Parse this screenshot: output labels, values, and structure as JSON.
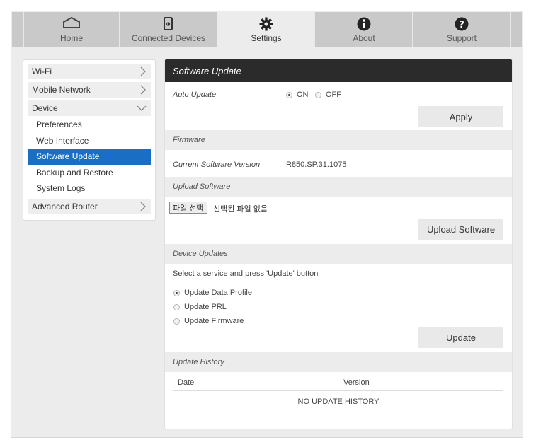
{
  "nav": {
    "tabs": [
      {
        "label": "Home",
        "icon": "home-icon"
      },
      {
        "label": "Connected Devices",
        "icon": "devices-icon"
      },
      {
        "label": "Settings",
        "icon": "gear-icon"
      },
      {
        "label": "About",
        "icon": "info-icon"
      },
      {
        "label": "Support",
        "icon": "help-icon"
      }
    ],
    "active": "Settings"
  },
  "sidebar": {
    "wifi": "Wi-Fi",
    "mobile_network": "Mobile Network",
    "device": "Device",
    "sub": [
      "Preferences",
      "Web Interface",
      "Software Update",
      "Backup and Restore",
      "System Logs"
    ],
    "advanced_router": "Advanced Router"
  },
  "main": {
    "title": "Software Update",
    "auto_update": {
      "label": "Auto Update",
      "on": "ON",
      "off": "OFF",
      "selected": "ON"
    },
    "apply": "Apply",
    "firmware": {
      "section": "Firmware",
      "label": "Current Software Version",
      "value": "R850.SP.31.1075"
    },
    "upload": {
      "section": "Upload Software",
      "choose": "파일 선택",
      "none": "선택된 파일 없음",
      "button": "Upload Software"
    },
    "device_updates": {
      "section": "Device Updates",
      "instruction": "Select a service and press 'Update' button",
      "options": [
        "Update Data Profile",
        "Update PRL",
        "Update Firmware"
      ],
      "selected": "Update Data Profile",
      "button": "Update"
    },
    "history": {
      "section": "Update History",
      "col_date": "Date",
      "col_version": "Version",
      "empty": "NO UPDATE HISTORY"
    }
  },
  "colors": {
    "accent": "#1a6fc4",
    "title_bar": "#2b2b2b",
    "nav_bg": "#c9c9c9"
  }
}
